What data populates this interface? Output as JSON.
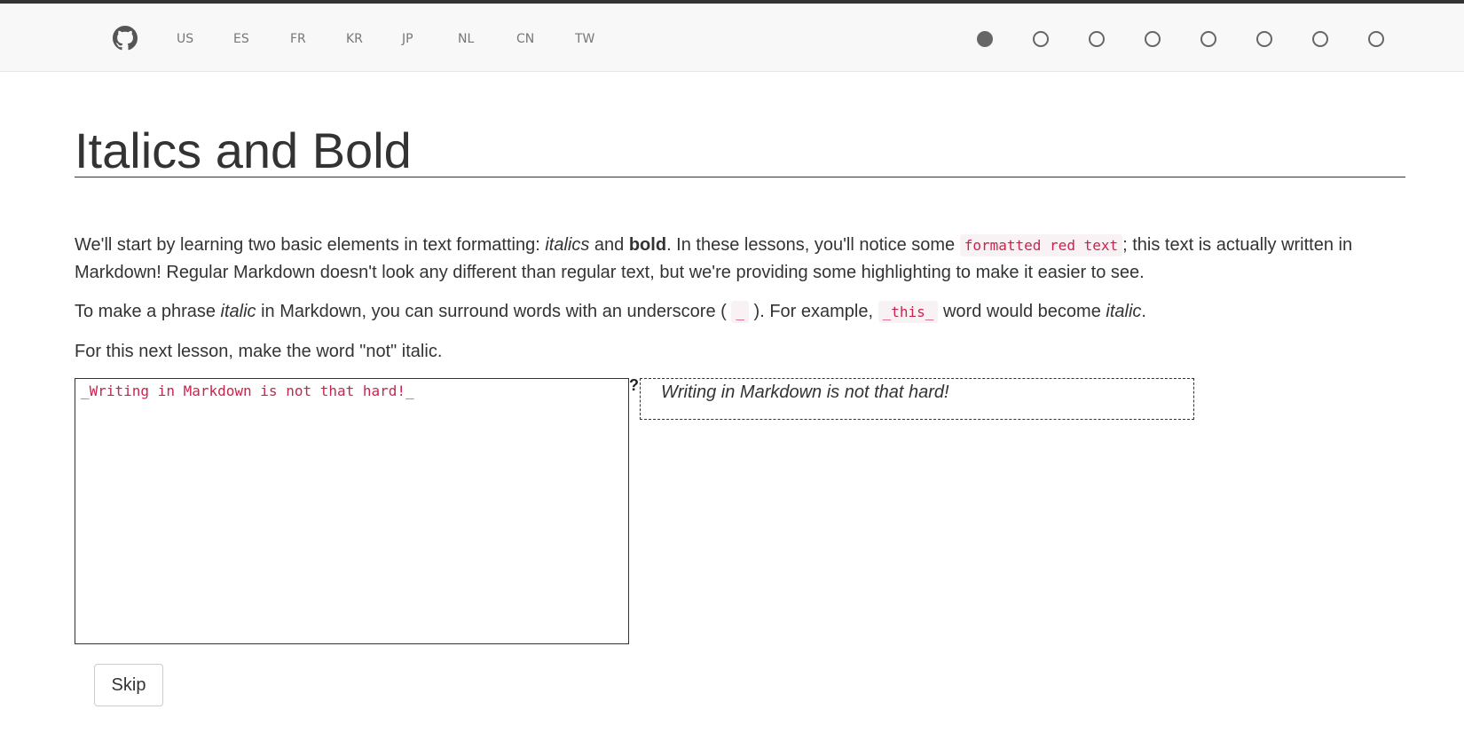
{
  "nav": {
    "github_icon": "github-icon",
    "languages": [
      "US",
      "ES",
      "FR",
      "KR",
      "JP",
      "NL",
      "CN",
      "TW"
    ],
    "progress": {
      "total_steps": 8,
      "current_step": 1
    }
  },
  "lesson": {
    "title": "Italics and Bold",
    "p1": {
      "t1": "We'll start by learning two basic elements in text formatting: ",
      "italics": "italics",
      "t2": " and ",
      "bold": "bold",
      "t3": ". In these lessons, you'll notice some ",
      "code": "formatted red text",
      "t4": "; this text is actually written in Markdown! Regular Markdown doesn't look any different than regular text, but we're providing some highlighting to make it easier to see."
    },
    "p2": {
      "t1": "To make a phrase ",
      "italic": "italic",
      "t2": " in Markdown, you can surround words with an underscore ( ",
      "code1": "_",
      "t3": " ). For example, ",
      "code2": "_this_",
      "t4": " word would become ",
      "italic2": "italic",
      "t5": "."
    },
    "p3": "For this next lesson, make the word \"not\" italic."
  },
  "editor": {
    "value": "_Writing in Markdown is not that hard!_"
  },
  "help_mark": "?",
  "preview": {
    "text": "Writing in Markdown is not that hard!"
  },
  "skip_label": "Skip",
  "colors": {
    "code_text": "#c7254e",
    "code_bg": "#f9f2f4",
    "navbar_bg": "#f8f8f8"
  }
}
